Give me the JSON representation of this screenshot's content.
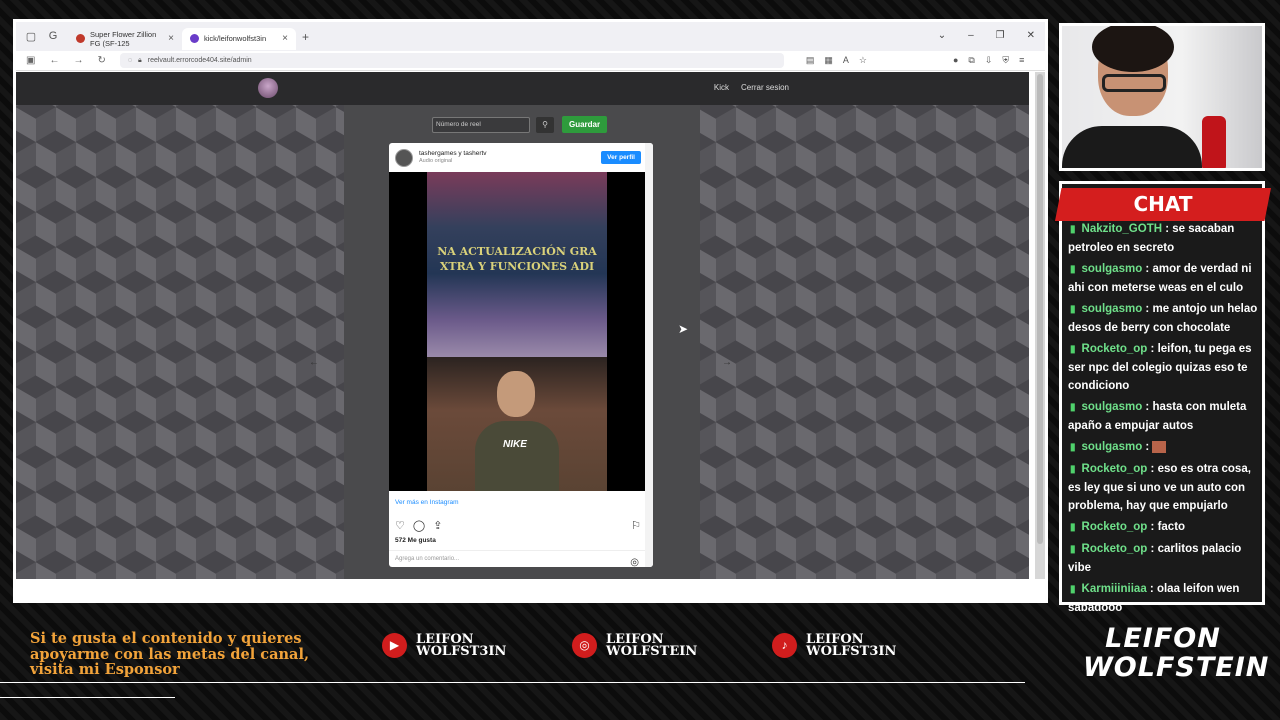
{
  "browser": {
    "tabs": [
      {
        "label": "Super Flower Zillion FG (SF-125"
      },
      {
        "label": "kick/leifonwolfst3in"
      }
    ],
    "url": "reelvault.errorcode404.site/admin"
  },
  "site": {
    "nav": [
      "Kick",
      "Cerrar sesion"
    ],
    "reel_placeholder": "Número de reel",
    "save_label": "Guardar"
  },
  "instagram": {
    "user": "tashergames y tashertv",
    "audio": "Audio original",
    "follow": "Ver perfil",
    "video_caption_line1": "NA ACTUALIZACIÓN GRA",
    "video_caption_line2": "XTRA Y FUNCIONES ADI",
    "shirt_logo": "NIKE",
    "more": "Ver más en Instagram",
    "likes": "572 Me gusta",
    "comment_placeholder": "Agrega un comentario..."
  },
  "chat": {
    "title": "CHAT",
    "messages": [
      {
        "user": "Nakzito_GOTH",
        "text": "se sacaban petroleo en secreto"
      },
      {
        "user": "soulgasmo",
        "text": "amor de verdad ni ahi con meterse weas en el culo"
      },
      {
        "user": "soulgasmo",
        "text": "me antojo un helao desos de berry con chocolate"
      },
      {
        "user": "Rocketo_op",
        "text": "leifon, tu pega es ser npc del colegio quizas eso te condiciono"
      },
      {
        "user": "soulgasmo",
        "text": "hasta con muleta apaño a empujar autos"
      },
      {
        "user": "soulgasmo",
        "text": ""
      },
      {
        "user": "Rocketo_op",
        "text": "eso es otra cosa, es ley que si uno ve un auto con problema, hay que empujarlo"
      },
      {
        "user": "Rocketo_op",
        "text": "facto"
      },
      {
        "user": "Rocketo_op",
        "text": "carlitos palacio vibe"
      },
      {
        "user": "Karmiiiniiaa",
        "text": "olaa leifon wen sabadooo"
      }
    ]
  },
  "overlay": {
    "sponsor": "Si te gusta el contenido y quieres apoyarme con las metas del canal, visita mi Esponsor",
    "socials": [
      {
        "icon": "youtube-icon",
        "line1": "LEIFON",
        "line2": "WOLFST3IN"
      },
      {
        "icon": "instagram-icon",
        "line1": "LEIFON",
        "line2": "WOLFSTEIN"
      },
      {
        "icon": "tiktok-icon",
        "line1": "LEIFON",
        "line2": "WOLFST3IN"
      }
    ],
    "brand_line1": "LEIFON",
    "brand_line2": "WOLFSTEIN"
  },
  "colors": {
    "accent_red": "#d41e1e",
    "chat_user": "#6fe08a",
    "sponsor_text": "#f2a33a",
    "save_green": "#2e9b3c",
    "ig_blue": "#1a8cff"
  }
}
